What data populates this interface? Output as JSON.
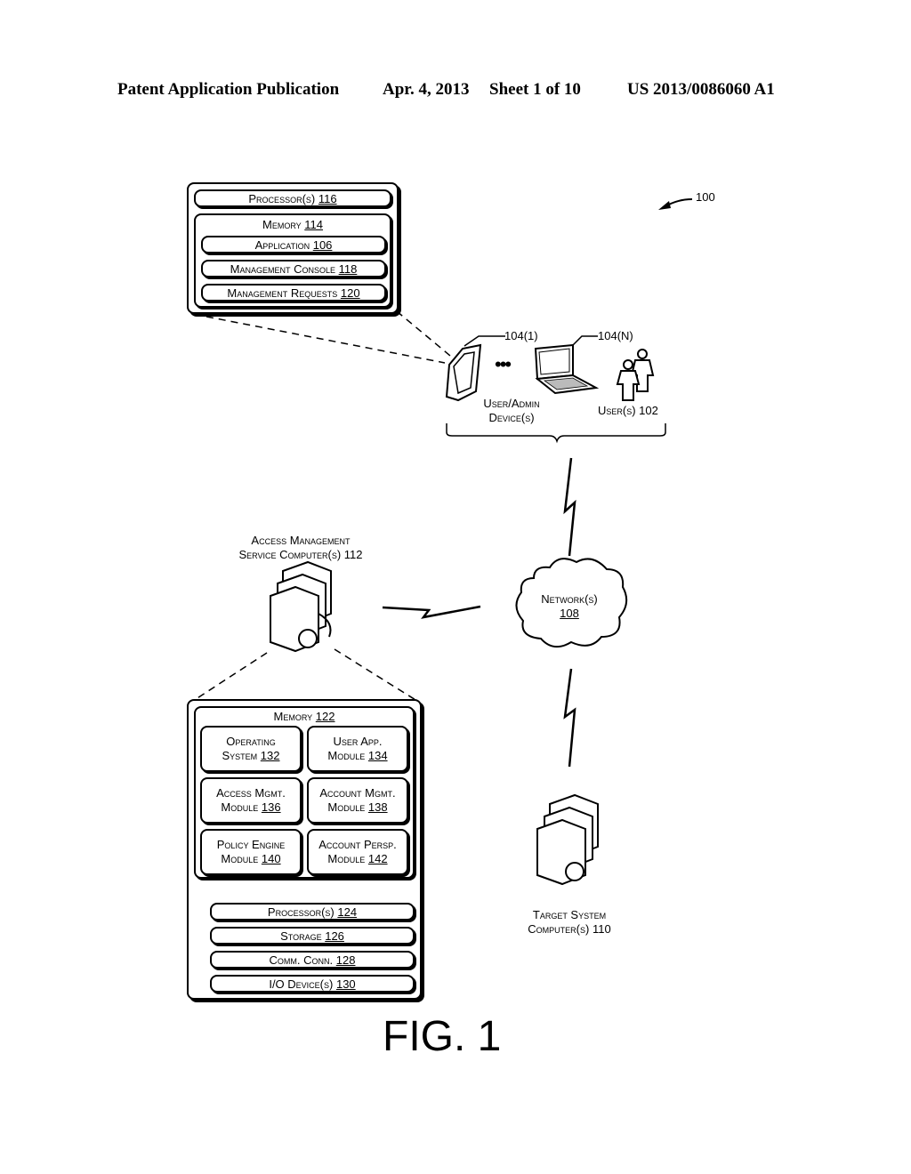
{
  "header": {
    "publication": "Patent Application Publication",
    "date": "Apr. 4, 2013",
    "sheet": "Sheet 1 of 10",
    "number": "US 2013/0086060 A1"
  },
  "ref_100": "100",
  "device_detail": {
    "processor": {
      "label": "Processor(s)",
      "ref": "116"
    },
    "memory": {
      "label": "Memory",
      "ref": "114"
    },
    "items": [
      {
        "label": "Application",
        "ref": "106"
      },
      {
        "label": "Management Console",
        "ref": "118"
      },
      {
        "label": "Management Requests",
        "ref": "120"
      }
    ]
  },
  "devices": {
    "tablet_ref": "104(1)",
    "laptop_ref": "104(N)",
    "ellipsis": "•••",
    "label_line1": "User/Admin",
    "label_line2": "Device(s)",
    "users_label": "User(s) 102"
  },
  "network": {
    "label": "Network(s)",
    "ref": "108"
  },
  "access_mgmt": {
    "label_line1": "Access Management",
    "label_line2": "Service Computer(s) 112"
  },
  "server_detail": {
    "memory": {
      "label": "Memory",
      "ref": "122"
    },
    "modules": [
      {
        "line1": "Operating",
        "line2": "System",
        "ref": "132"
      },
      {
        "line1": "User App.",
        "line2": "Module",
        "ref": "134"
      },
      {
        "line1": "Access Mgmt.",
        "line2": "Module",
        "ref": "136"
      },
      {
        "line1": "Account Mgmt.",
        "line2": "Module",
        "ref": "138"
      },
      {
        "line1": "Policy Engine",
        "line2": "Module",
        "ref": "140"
      },
      {
        "line1": "Account Persp.",
        "line2": "Module",
        "ref": "142"
      }
    ],
    "components": [
      {
        "label": "Processor(s)",
        "ref": "124"
      },
      {
        "label": "Storage",
        "ref": "126"
      },
      {
        "label": "Comm. Conn.",
        "ref": "128"
      },
      {
        "label": "I/O Device(s)",
        "ref": "130"
      }
    ]
  },
  "target": {
    "label_line1": "Target System",
    "label_line2": "Computer(s) 110"
  },
  "figure_label": "FIG. 1"
}
